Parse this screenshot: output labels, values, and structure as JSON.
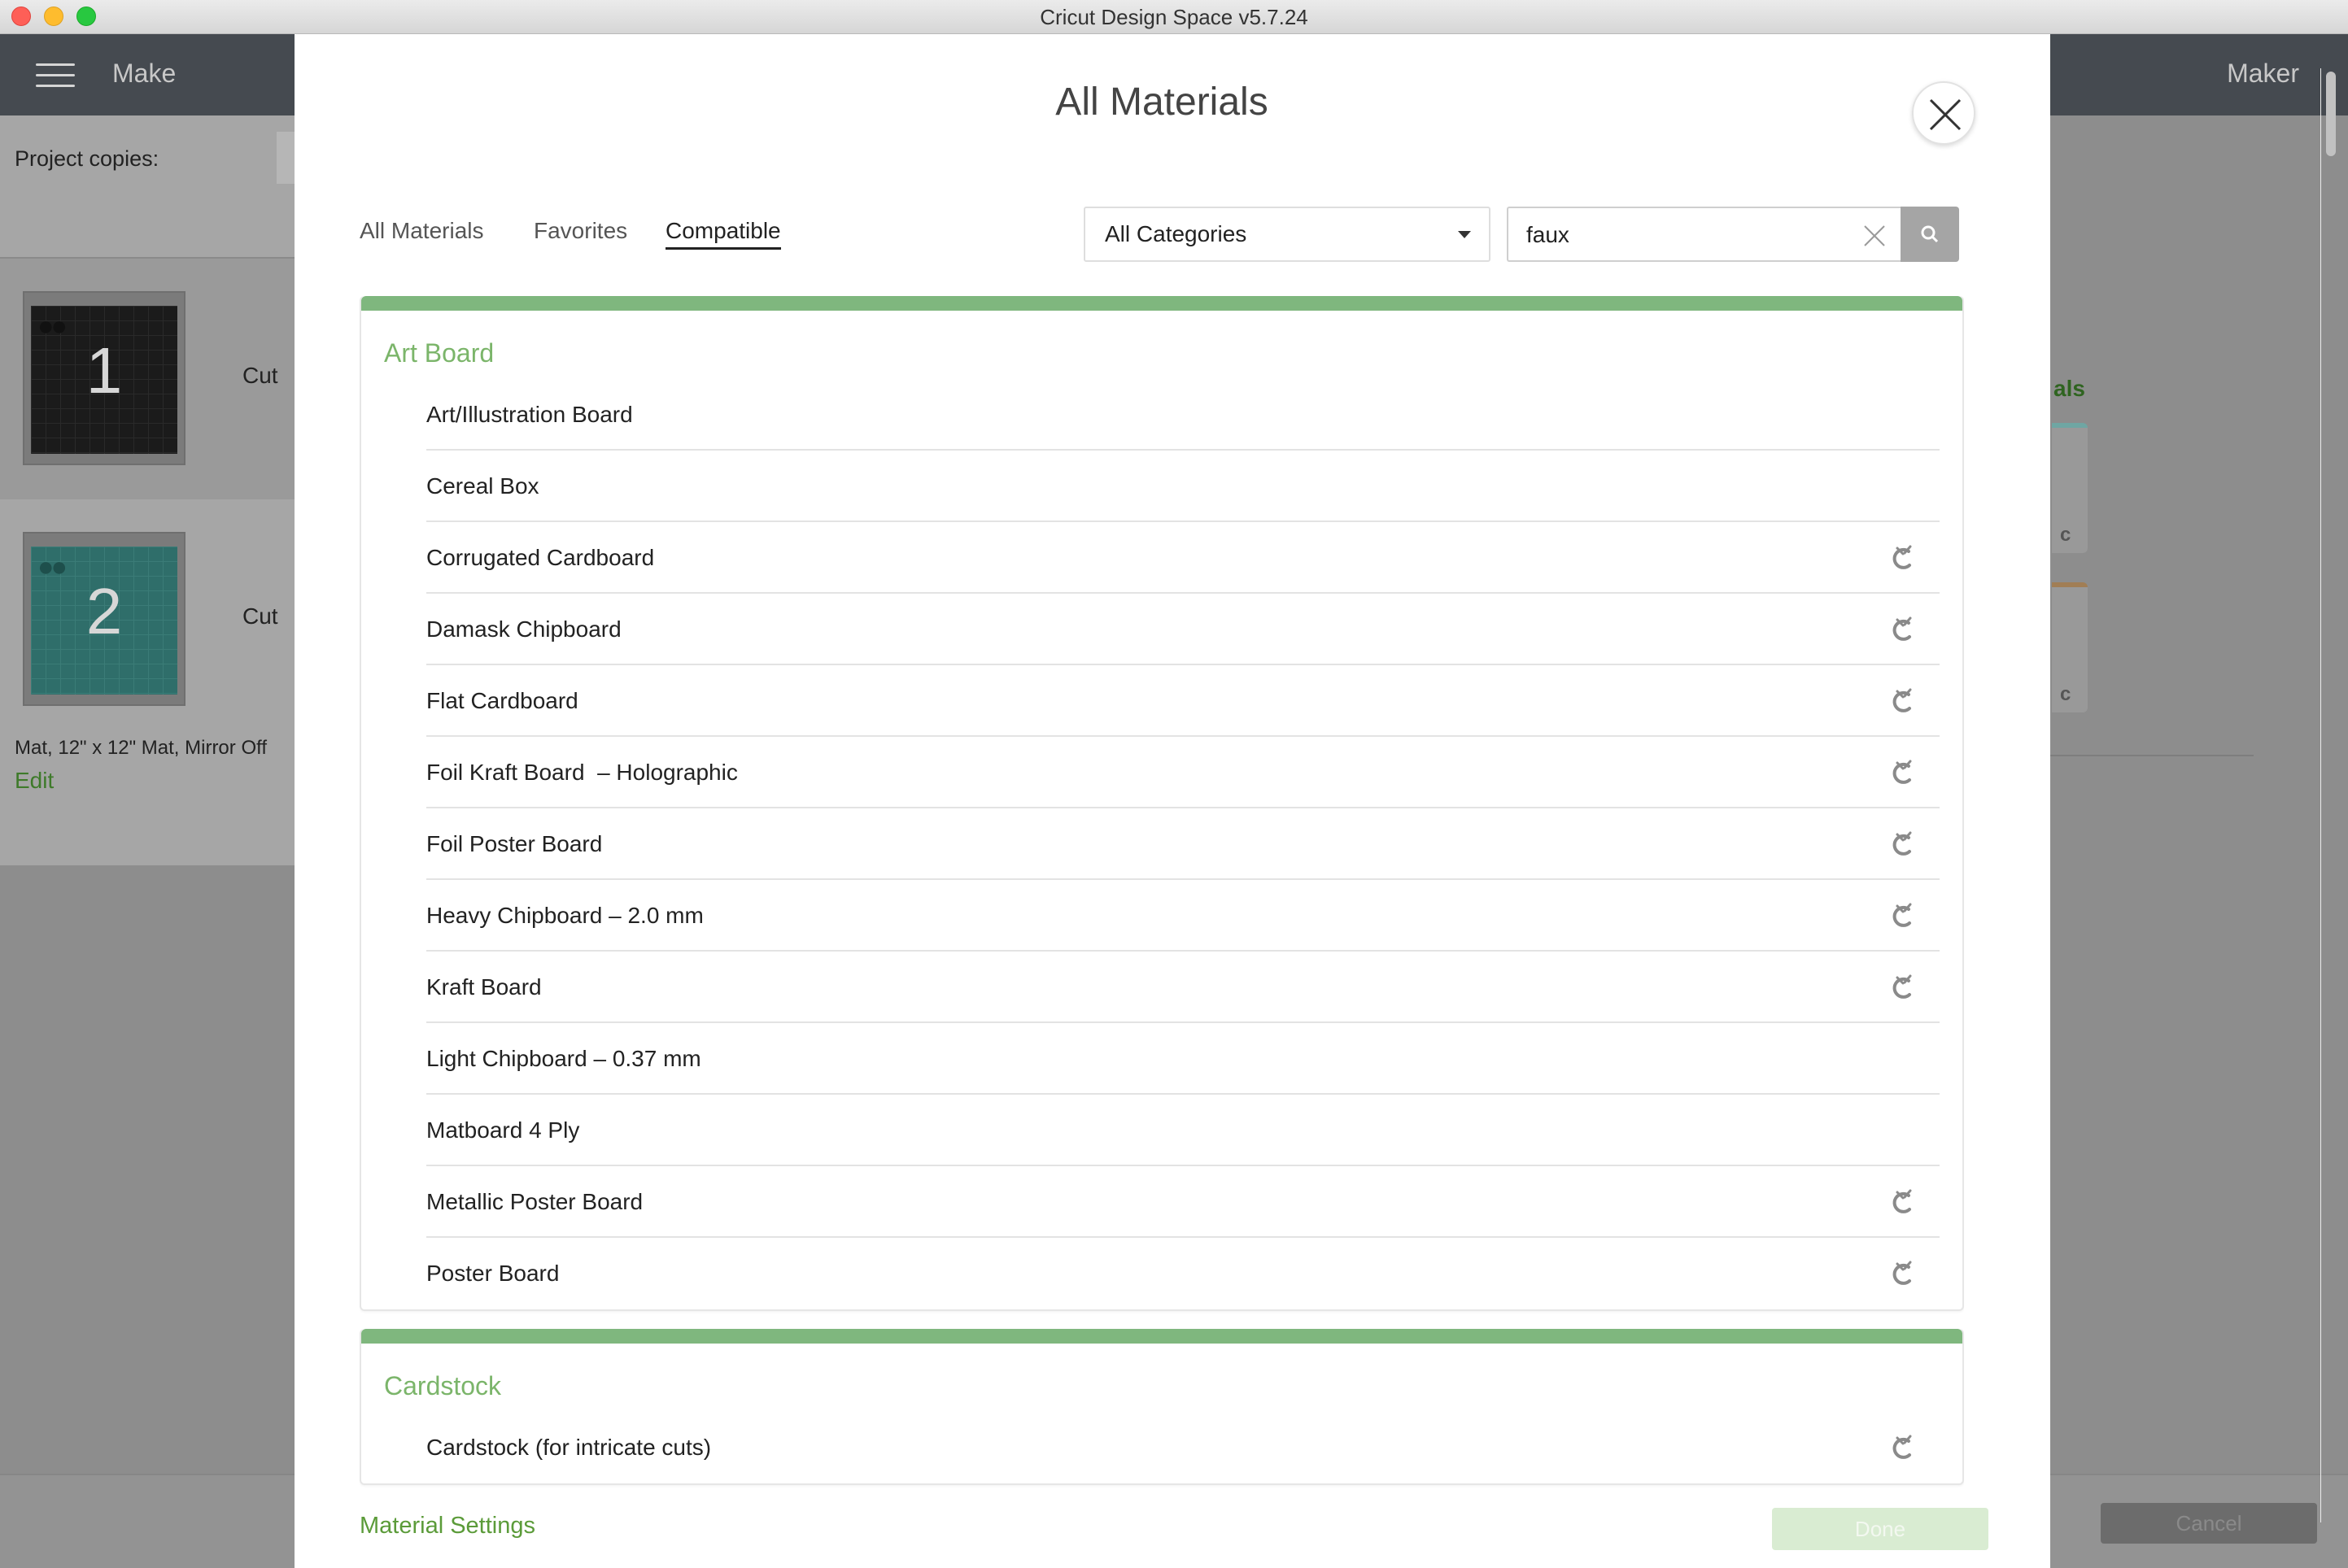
{
  "window": {
    "title": "Cricut Design Space  v5.7.24"
  },
  "app": {
    "title": "Make",
    "machine": "Maker",
    "project_copies_label": "Project copies:",
    "mats": [
      {
        "number": "1",
        "action": "Cut"
      },
      {
        "number": "2",
        "action": "Cut"
      }
    ],
    "mat_info": "Mat, 12\" x 12\" Mat, Mirror Off",
    "edit_label": "Edit",
    "right_partial_label": "als",
    "cancel_label": "Cancel"
  },
  "modal": {
    "title": "All Materials",
    "tabs": [
      {
        "label": "All Materials",
        "active": false
      },
      {
        "label": "Favorites",
        "active": false
      },
      {
        "label": "Compatible",
        "active": true
      }
    ],
    "category_select": {
      "value": "All Categories"
    },
    "search": {
      "value": "faux",
      "placeholder": ""
    },
    "categories": [
      {
        "name": "Art Board",
        "items": [
          {
            "label": "Art/Illustration Board",
            "cricut_icon": false
          },
          {
            "label": "Cereal Box",
            "cricut_icon": false
          },
          {
            "label": "Corrugated Cardboard",
            "cricut_icon": true
          },
          {
            "label": "Damask Chipboard",
            "cricut_icon": true
          },
          {
            "label": "Flat Cardboard",
            "cricut_icon": true
          },
          {
            "label": "Foil Kraft Board  – Holographic",
            "cricut_icon": true
          },
          {
            "label": "Foil Poster Board",
            "cricut_icon": true
          },
          {
            "label": "Heavy Chipboard – 2.0 mm",
            "cricut_icon": true
          },
          {
            "label": "Kraft Board",
            "cricut_icon": true
          },
          {
            "label": "Light Chipboard – 0.37 mm",
            "cricut_icon": false
          },
          {
            "label": "Matboard 4 Ply",
            "cricut_icon": false
          },
          {
            "label": "Metallic Poster Board",
            "cricut_icon": true
          },
          {
            "label": "Poster Board",
            "cricut_icon": true
          }
        ]
      },
      {
        "name": "Cardstock",
        "items": [
          {
            "label": "Cardstock (for intricate cuts)",
            "cricut_icon": true
          }
        ]
      }
    ],
    "footer": {
      "material_settings_label": "Material Settings",
      "done_label": "Done"
    }
  },
  "colors": {
    "accent_green": "#7fb77e",
    "link_green": "#5b9b39",
    "header_dark": "#454a50"
  }
}
